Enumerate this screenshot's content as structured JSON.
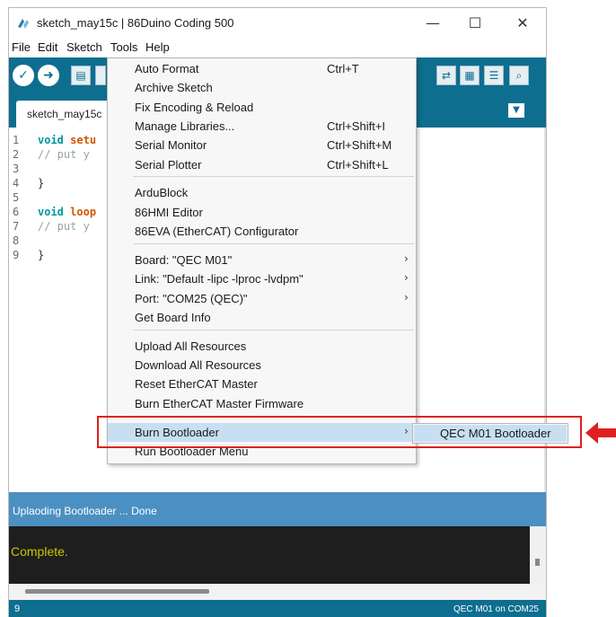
{
  "window": {
    "title": "sketch_may15c | 86Duino Coding 500",
    "controls": {
      "minimize": "—",
      "maximize": "☐",
      "close": "✕"
    }
  },
  "menubar": [
    "File",
    "Edit",
    "Sketch",
    "Tools",
    "Help"
  ],
  "toolbar": {
    "left_icons": [
      "verify-icon",
      "upload-icon",
      "new-icon",
      "open-icon"
    ],
    "right_icons": [
      "switch-icon",
      "grid-icon",
      "list-icon",
      "serial-monitor-icon"
    ]
  },
  "tab": {
    "label": "sketch_may15c"
  },
  "code_lines": [
    {
      "n": "1",
      "kw": "void",
      "fn": "setu",
      "rest": "",
      "comment": ""
    },
    {
      "n": "2",
      "kw": "",
      "fn": "",
      "rest": "",
      "comment": "// put y"
    },
    {
      "n": "3",
      "kw": "",
      "fn": "",
      "rest": "",
      "comment": ""
    },
    {
      "n": "4",
      "kw": "",
      "fn": "",
      "rest": "}",
      "comment": ""
    },
    {
      "n": "5",
      "kw": "",
      "fn": "",
      "rest": "",
      "comment": ""
    },
    {
      "n": "6",
      "kw": "void",
      "fn": "loop",
      "rest": "",
      "comment": ""
    },
    {
      "n": "7",
      "kw": "",
      "fn": "",
      "rest": "",
      "comment": "// put y"
    },
    {
      "n": "8",
      "kw": "",
      "fn": "",
      "rest": "",
      "comment": ""
    },
    {
      "n": "9",
      "kw": "",
      "fn": "",
      "rest": "}",
      "comment": ""
    }
  ],
  "tools_menu": [
    {
      "label": "Auto Format",
      "shortcut": "Ctrl+T"
    },
    {
      "label": "Archive Sketch",
      "shortcut": ""
    },
    {
      "label": "Fix Encoding & Reload",
      "shortcut": ""
    },
    {
      "label": "Manage Libraries...",
      "shortcut": "Ctrl+Shift+I"
    },
    {
      "label": "Serial Monitor",
      "shortcut": "Ctrl+Shift+M"
    },
    {
      "label": "Serial Plotter",
      "shortcut": "Ctrl+Shift+L"
    },
    {
      "label": "ArduBlock",
      "shortcut": ""
    },
    {
      "label": "86HMI Editor",
      "shortcut": ""
    },
    {
      "label": "86EVA (EtherCAT) Configurator",
      "shortcut": ""
    },
    {
      "label": "Board: \"QEC M01\"",
      "shortcut": "",
      "submenu": true
    },
    {
      "label": "Link: \"Default -lipc -lproc -lvdpm\"",
      "shortcut": "",
      "submenu": true
    },
    {
      "label": "Port: \"COM25 (QEC)\"",
      "shortcut": "",
      "submenu": true
    },
    {
      "label": "Get Board Info",
      "shortcut": ""
    },
    {
      "label": "Upload All Resources",
      "shortcut": ""
    },
    {
      "label": "Download All Resources",
      "shortcut": ""
    },
    {
      "label": "Reset EtherCAT Master",
      "shortcut": ""
    },
    {
      "label": "Burn EtherCAT Master Firmware",
      "shortcut": ""
    },
    {
      "label": "Burn Bootloader",
      "shortcut": "",
      "submenu": true,
      "highlighted": true
    },
    {
      "label": "Run Bootloader Menu",
      "shortcut": ""
    }
  ],
  "submenu": {
    "label": "QEC M01 Bootloader"
  },
  "status": {
    "text": "Uplaoding Bootloader ... Done"
  },
  "console": {
    "text": "Complete."
  },
  "bottom": {
    "line": "9",
    "board": "QEC M01 on COM25"
  },
  "colors": {
    "toolbar": "#0e6e8f",
    "status": "#4b90c2",
    "highlight": "#c8dff3",
    "annotation": "#e02020"
  }
}
